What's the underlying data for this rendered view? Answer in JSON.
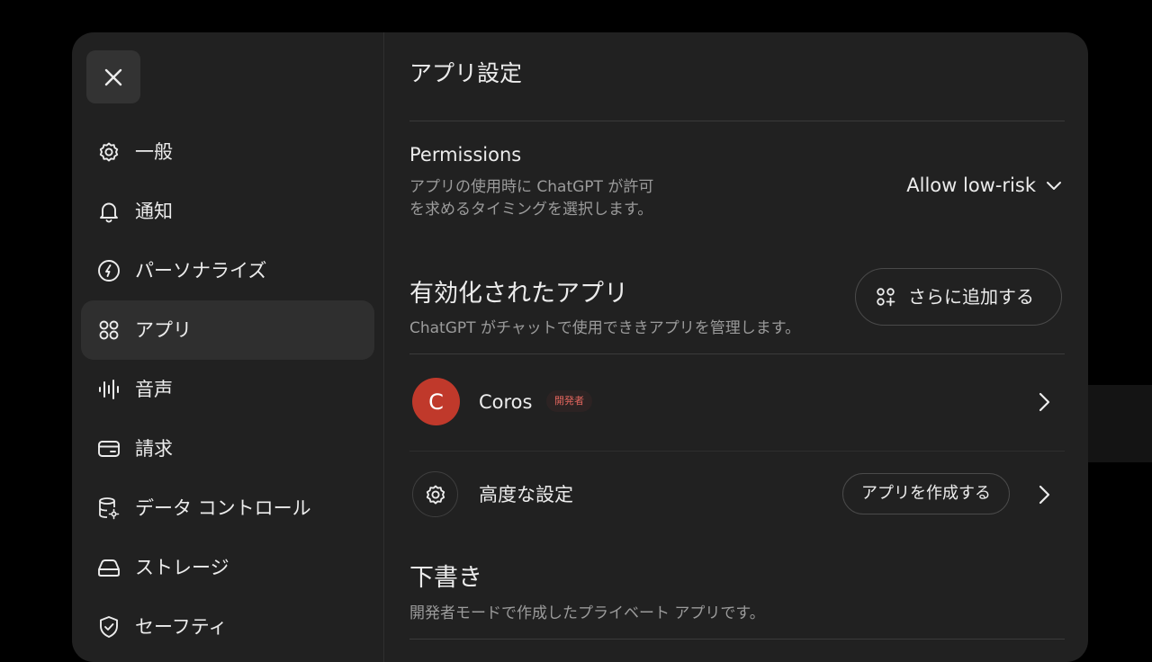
{
  "sidebar": {
    "close_icon": "close-icon",
    "items": [
      {
        "label": "一般",
        "icon": "gear-icon",
        "active": false
      },
      {
        "label": "通知",
        "icon": "bell-icon",
        "active": false
      },
      {
        "label": "パーソナライズ",
        "icon": "personalize-icon",
        "active": false
      },
      {
        "label": "アプリ",
        "icon": "apps-grid-icon",
        "active": true
      },
      {
        "label": "音声",
        "icon": "voice-waveform-icon",
        "active": false
      },
      {
        "label": "請求",
        "icon": "credit-card-icon",
        "active": false
      },
      {
        "label": "データ コントロール",
        "icon": "database-gear-icon",
        "active": false
      },
      {
        "label": "ストレージ",
        "icon": "storage-icon",
        "active": false
      },
      {
        "label": "セーフティ",
        "icon": "shield-check-icon",
        "active": false
      }
    ]
  },
  "main": {
    "title": "アプリ設定",
    "permissions": {
      "title": "Permissions",
      "description_line1": "アプリの使用時に ChatGPT が許可",
      "description_line2": "を求めるタイミングを選択します。",
      "selected": "Allow low-risk"
    },
    "enabled_apps": {
      "title": "有効化されたアプリ",
      "description": "ChatGPT がチャットで使用でききアプリを管理します。",
      "add_more_label": "さらに追加する"
    },
    "apps": [
      {
        "initial": "C",
        "name": "Coros",
        "badge": "開発者"
      }
    ],
    "advanced": {
      "label": "高度な設定",
      "create_app_label": "アプリを作成する"
    },
    "drafts": {
      "title": "下書き",
      "description": "開発者モードで作成したプライベート アプリです。"
    }
  },
  "colors": {
    "background": "#000000",
    "modal": "#212121",
    "active_nav": "#2f2f2f",
    "avatar": "#c0392b",
    "badge_text": "#e0655d",
    "muted_text": "#9b9b9b"
  }
}
